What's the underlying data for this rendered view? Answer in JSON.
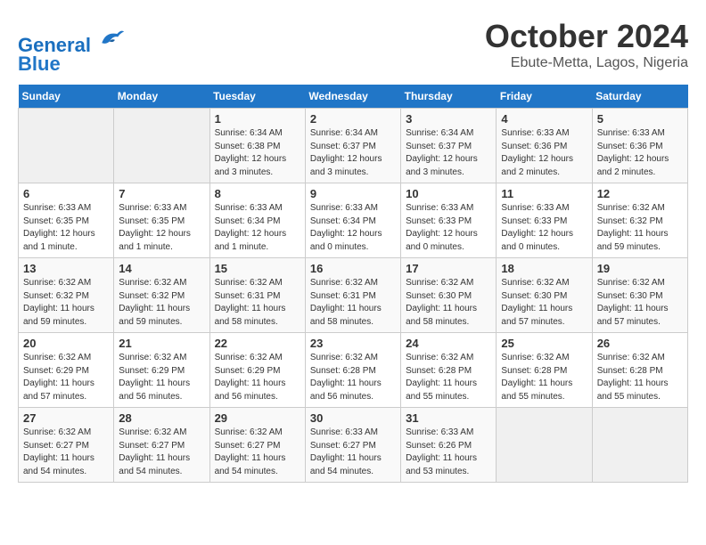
{
  "header": {
    "logo_line1": "General",
    "logo_line2": "Blue",
    "title": "October 2024",
    "subtitle": "Ebute-Metta, Lagos, Nigeria"
  },
  "weekdays": [
    "Sunday",
    "Monday",
    "Tuesday",
    "Wednesday",
    "Thursday",
    "Friday",
    "Saturday"
  ],
  "weeks": [
    [
      {
        "day": "",
        "info": ""
      },
      {
        "day": "",
        "info": ""
      },
      {
        "day": "1",
        "info": "Sunrise: 6:34 AM\nSunset: 6:38 PM\nDaylight: 12 hours and 3 minutes."
      },
      {
        "day": "2",
        "info": "Sunrise: 6:34 AM\nSunset: 6:37 PM\nDaylight: 12 hours and 3 minutes."
      },
      {
        "day": "3",
        "info": "Sunrise: 6:34 AM\nSunset: 6:37 PM\nDaylight: 12 hours and 3 minutes."
      },
      {
        "day": "4",
        "info": "Sunrise: 6:33 AM\nSunset: 6:36 PM\nDaylight: 12 hours and 2 minutes."
      },
      {
        "day": "5",
        "info": "Sunrise: 6:33 AM\nSunset: 6:36 PM\nDaylight: 12 hours and 2 minutes."
      }
    ],
    [
      {
        "day": "6",
        "info": "Sunrise: 6:33 AM\nSunset: 6:35 PM\nDaylight: 12 hours and 1 minute."
      },
      {
        "day": "7",
        "info": "Sunrise: 6:33 AM\nSunset: 6:35 PM\nDaylight: 12 hours and 1 minute."
      },
      {
        "day": "8",
        "info": "Sunrise: 6:33 AM\nSunset: 6:34 PM\nDaylight: 12 hours and 1 minute."
      },
      {
        "day": "9",
        "info": "Sunrise: 6:33 AM\nSunset: 6:34 PM\nDaylight: 12 hours and 0 minutes."
      },
      {
        "day": "10",
        "info": "Sunrise: 6:33 AM\nSunset: 6:33 PM\nDaylight: 12 hours and 0 minutes."
      },
      {
        "day": "11",
        "info": "Sunrise: 6:33 AM\nSunset: 6:33 PM\nDaylight: 12 hours and 0 minutes."
      },
      {
        "day": "12",
        "info": "Sunrise: 6:32 AM\nSunset: 6:32 PM\nDaylight: 11 hours and 59 minutes."
      }
    ],
    [
      {
        "day": "13",
        "info": "Sunrise: 6:32 AM\nSunset: 6:32 PM\nDaylight: 11 hours and 59 minutes."
      },
      {
        "day": "14",
        "info": "Sunrise: 6:32 AM\nSunset: 6:32 PM\nDaylight: 11 hours and 59 minutes."
      },
      {
        "day": "15",
        "info": "Sunrise: 6:32 AM\nSunset: 6:31 PM\nDaylight: 11 hours and 58 minutes."
      },
      {
        "day": "16",
        "info": "Sunrise: 6:32 AM\nSunset: 6:31 PM\nDaylight: 11 hours and 58 minutes."
      },
      {
        "day": "17",
        "info": "Sunrise: 6:32 AM\nSunset: 6:30 PM\nDaylight: 11 hours and 58 minutes."
      },
      {
        "day": "18",
        "info": "Sunrise: 6:32 AM\nSunset: 6:30 PM\nDaylight: 11 hours and 57 minutes."
      },
      {
        "day": "19",
        "info": "Sunrise: 6:32 AM\nSunset: 6:30 PM\nDaylight: 11 hours and 57 minutes."
      }
    ],
    [
      {
        "day": "20",
        "info": "Sunrise: 6:32 AM\nSunset: 6:29 PM\nDaylight: 11 hours and 57 minutes."
      },
      {
        "day": "21",
        "info": "Sunrise: 6:32 AM\nSunset: 6:29 PM\nDaylight: 11 hours and 56 minutes."
      },
      {
        "day": "22",
        "info": "Sunrise: 6:32 AM\nSunset: 6:29 PM\nDaylight: 11 hours and 56 minutes."
      },
      {
        "day": "23",
        "info": "Sunrise: 6:32 AM\nSunset: 6:28 PM\nDaylight: 11 hours and 56 minutes."
      },
      {
        "day": "24",
        "info": "Sunrise: 6:32 AM\nSunset: 6:28 PM\nDaylight: 11 hours and 55 minutes."
      },
      {
        "day": "25",
        "info": "Sunrise: 6:32 AM\nSunset: 6:28 PM\nDaylight: 11 hours and 55 minutes."
      },
      {
        "day": "26",
        "info": "Sunrise: 6:32 AM\nSunset: 6:28 PM\nDaylight: 11 hours and 55 minutes."
      }
    ],
    [
      {
        "day": "27",
        "info": "Sunrise: 6:32 AM\nSunset: 6:27 PM\nDaylight: 11 hours and 54 minutes."
      },
      {
        "day": "28",
        "info": "Sunrise: 6:32 AM\nSunset: 6:27 PM\nDaylight: 11 hours and 54 minutes."
      },
      {
        "day": "29",
        "info": "Sunrise: 6:32 AM\nSunset: 6:27 PM\nDaylight: 11 hours and 54 minutes."
      },
      {
        "day": "30",
        "info": "Sunrise: 6:33 AM\nSunset: 6:27 PM\nDaylight: 11 hours and 54 minutes."
      },
      {
        "day": "31",
        "info": "Sunrise: 6:33 AM\nSunset: 6:26 PM\nDaylight: 11 hours and 53 minutes."
      },
      {
        "day": "",
        "info": ""
      },
      {
        "day": "",
        "info": ""
      }
    ]
  ]
}
